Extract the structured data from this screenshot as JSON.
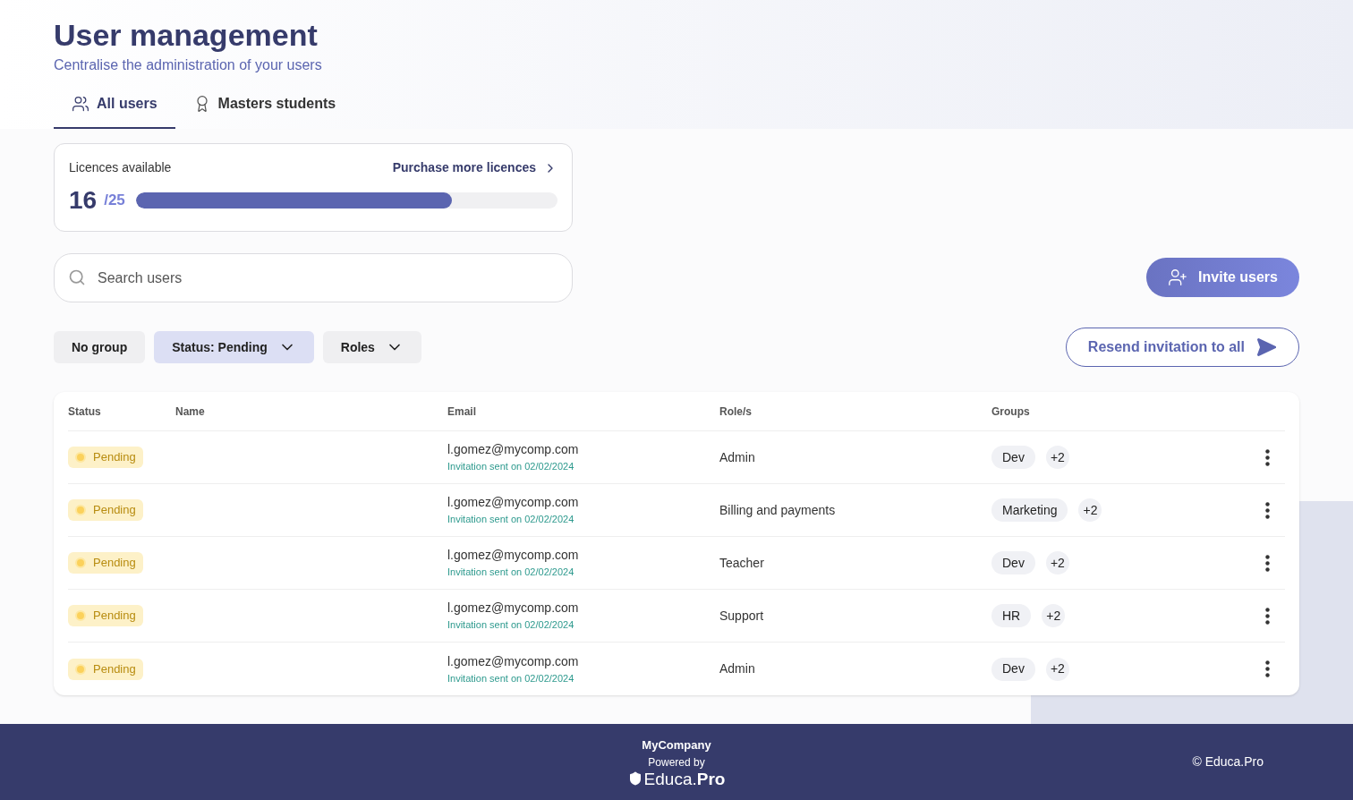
{
  "header": {
    "title": "User management",
    "subtitle": "Centralise the administration of your users"
  },
  "tabs": [
    {
      "label": "All users",
      "selected": true
    },
    {
      "label": "Masters students",
      "selected": false
    }
  ],
  "licences": {
    "label": "Licences available",
    "link": "Purchase more licences",
    "used": "16",
    "total": "/25",
    "level": 0.75
  },
  "search": {
    "placeholder": "Search users"
  },
  "invite_button": "Invite users",
  "filters": [
    {
      "label": "No group",
      "dropdown": false,
      "selected": false
    },
    {
      "label": "Status: Pending",
      "dropdown": true,
      "selected": true
    },
    {
      "label": "Roles",
      "dropdown": true,
      "selected": false
    }
  ],
  "resend_button": "Resend invitation to all",
  "table": {
    "columns": [
      "Status",
      "Name",
      "Email",
      "Role/s",
      "Groups"
    ],
    "rows": [
      {
        "status": "Pending",
        "email": "l.gomez@mycomp.com",
        "note": "Invitation sent on 02/02/2024",
        "role": "Admin",
        "group": "Dev",
        "more": "+2"
      },
      {
        "status": "Pending",
        "email": "l.gomez@mycomp.com",
        "note": "Invitation sent on 02/02/2024",
        "role": "Billing and payments",
        "group": "Marketing",
        "more": "+2"
      },
      {
        "status": "Pending",
        "email": "l.gomez@mycomp.com",
        "note": "Invitation sent on 02/02/2024",
        "role": "Teacher",
        "group": "Dev",
        "more": "+2"
      },
      {
        "status": "Pending",
        "email": "l.gomez@mycomp.com",
        "note": "Invitation sent on 02/02/2024",
        "role": "Support",
        "group": "HR",
        "more": "+2"
      },
      {
        "status": "Pending",
        "email": "l.gomez@mycomp.com",
        "note": "Invitation sent on 02/02/2024",
        "role": "Admin",
        "group": "Dev",
        "more": "+2"
      }
    ]
  },
  "footer": {
    "company": "MyCompany",
    "powered": "Powered by",
    "logo": "Educa.**Pro**",
    "copyright": "© Educa.Pro"
  }
}
